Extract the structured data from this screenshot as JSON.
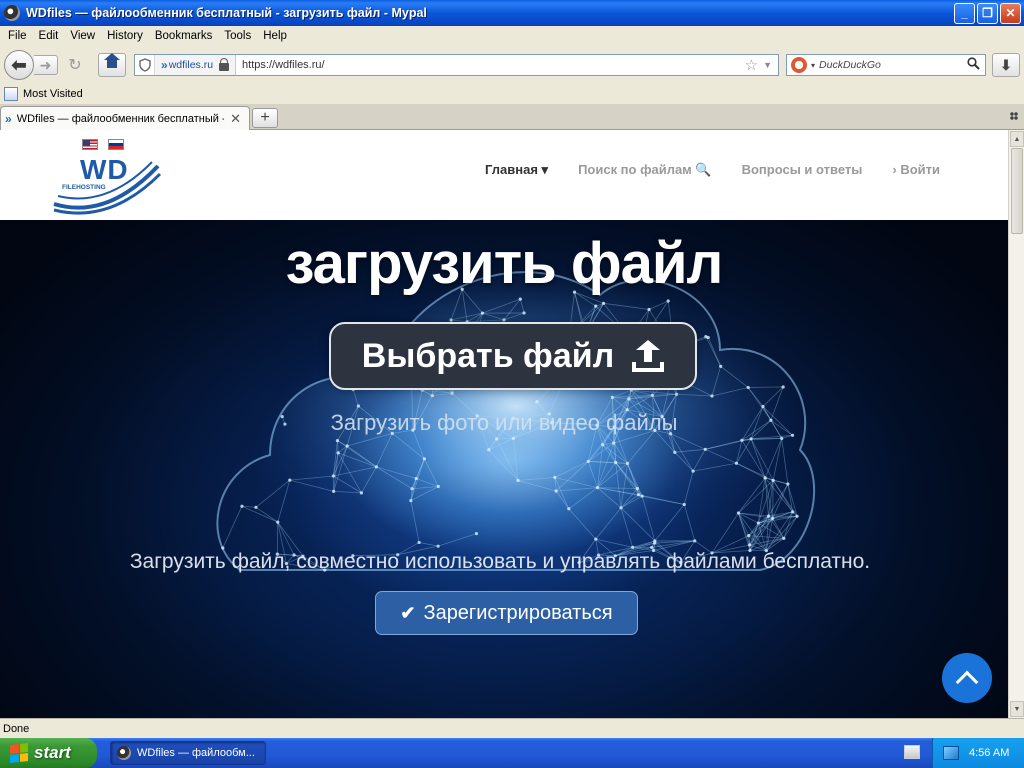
{
  "window": {
    "title": "WDfiles — файлообменник бесплатный - загрузить файл - Mypal",
    "controls": {
      "minimize": "_",
      "maximize": "❐",
      "close": "✕"
    }
  },
  "menubar": [
    "File",
    "Edit",
    "View",
    "History",
    "Bookmarks",
    "Tools",
    "Help"
  ],
  "navigation": {
    "back": "⬅",
    "forward": "➜",
    "reload": "↻",
    "site_identity": "wdfiles.ru",
    "url": "https://wdfiles.ru/",
    "bookmark_star": "☆",
    "url_dropdown": "▼",
    "search_placeholder": "DuckDuckGo",
    "search_caret": "▾",
    "search_icon": "🔍",
    "download": "⬇"
  },
  "bookmarks": {
    "items": [
      "Most Visited"
    ]
  },
  "tabs": {
    "items": [
      {
        "title": "WDfiles — файлообменник бесплатный - з...",
        "close": "✕"
      }
    ],
    "new_tab": "+"
  },
  "site": {
    "logo_text": "WD",
    "logo_subtext": "FILEHOSTING",
    "nav": [
      {
        "label": "Главная ▾",
        "active": true
      },
      {
        "label": "Поиск по файлам 🔍",
        "active": false
      },
      {
        "label": "Вопросы и ответы",
        "active": false
      },
      {
        "label": "› Войти",
        "active": false
      }
    ]
  },
  "hero": {
    "title": "загрузить файл",
    "choose_button": "Выбрать файл",
    "subtitle": "Загрузить фото или видео файлы",
    "tagline": "Загрузить файл, совместно использовать и управлять файлами бесплатно.",
    "register_check": "✔",
    "register_button": "Зарегистрироваться"
  },
  "scrollbar": {
    "up": "▲",
    "down": "▼"
  },
  "status": {
    "text": "Done"
  },
  "taskbar": {
    "start_label": "start",
    "task_title": "WDfiles — файлообм...",
    "clock": "4:56 AM"
  },
  "colors": {
    "titlebar": "#0b57d8",
    "accent_blue": "#1a73d8",
    "register_button": "#2c5fa3",
    "choose_button": "#2e3340"
  }
}
